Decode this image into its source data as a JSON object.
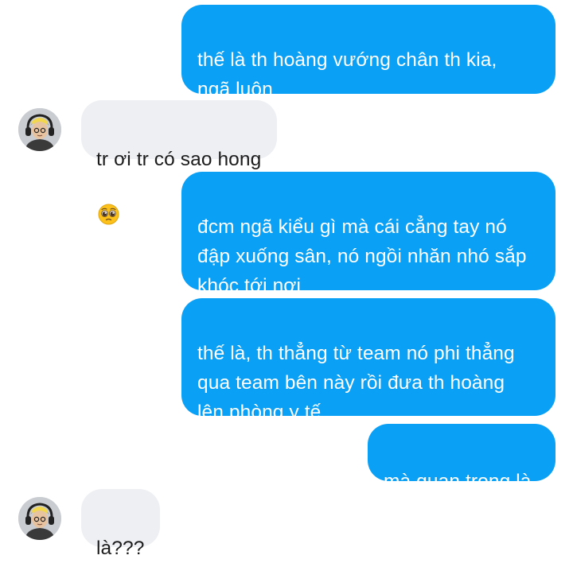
{
  "messages": [
    {
      "from": "me",
      "text": "thế là th hoàng vướng chân th kia,\nngã luôn"
    },
    {
      "from": "them",
      "text": "tr ơi tr có sao hong",
      "emoji": "pleading-face-emoji"
    },
    {
      "from": "me",
      "text": "đcm ngã kiểu gì mà cái cẳng tay nó\nđập xuống sân, nó ngồi nhăn nhó sắp\nkhóc tới nơi"
    },
    {
      "from": "me",
      "text": "thế là, th thẳng từ team nó phi thẳng\nqua team bên này rồi đưa th hoàng\nlên phòng y tế"
    },
    {
      "from": "me",
      "text": "mà quan trọng là"
    },
    {
      "from": "them",
      "text": "là???"
    }
  ],
  "colors": {
    "outgoing_bubble": "#0aa0f6",
    "outgoing_text": "#ffffff",
    "incoming_bubble": "#eeeff3",
    "incoming_text": "#1c1c1c"
  }
}
